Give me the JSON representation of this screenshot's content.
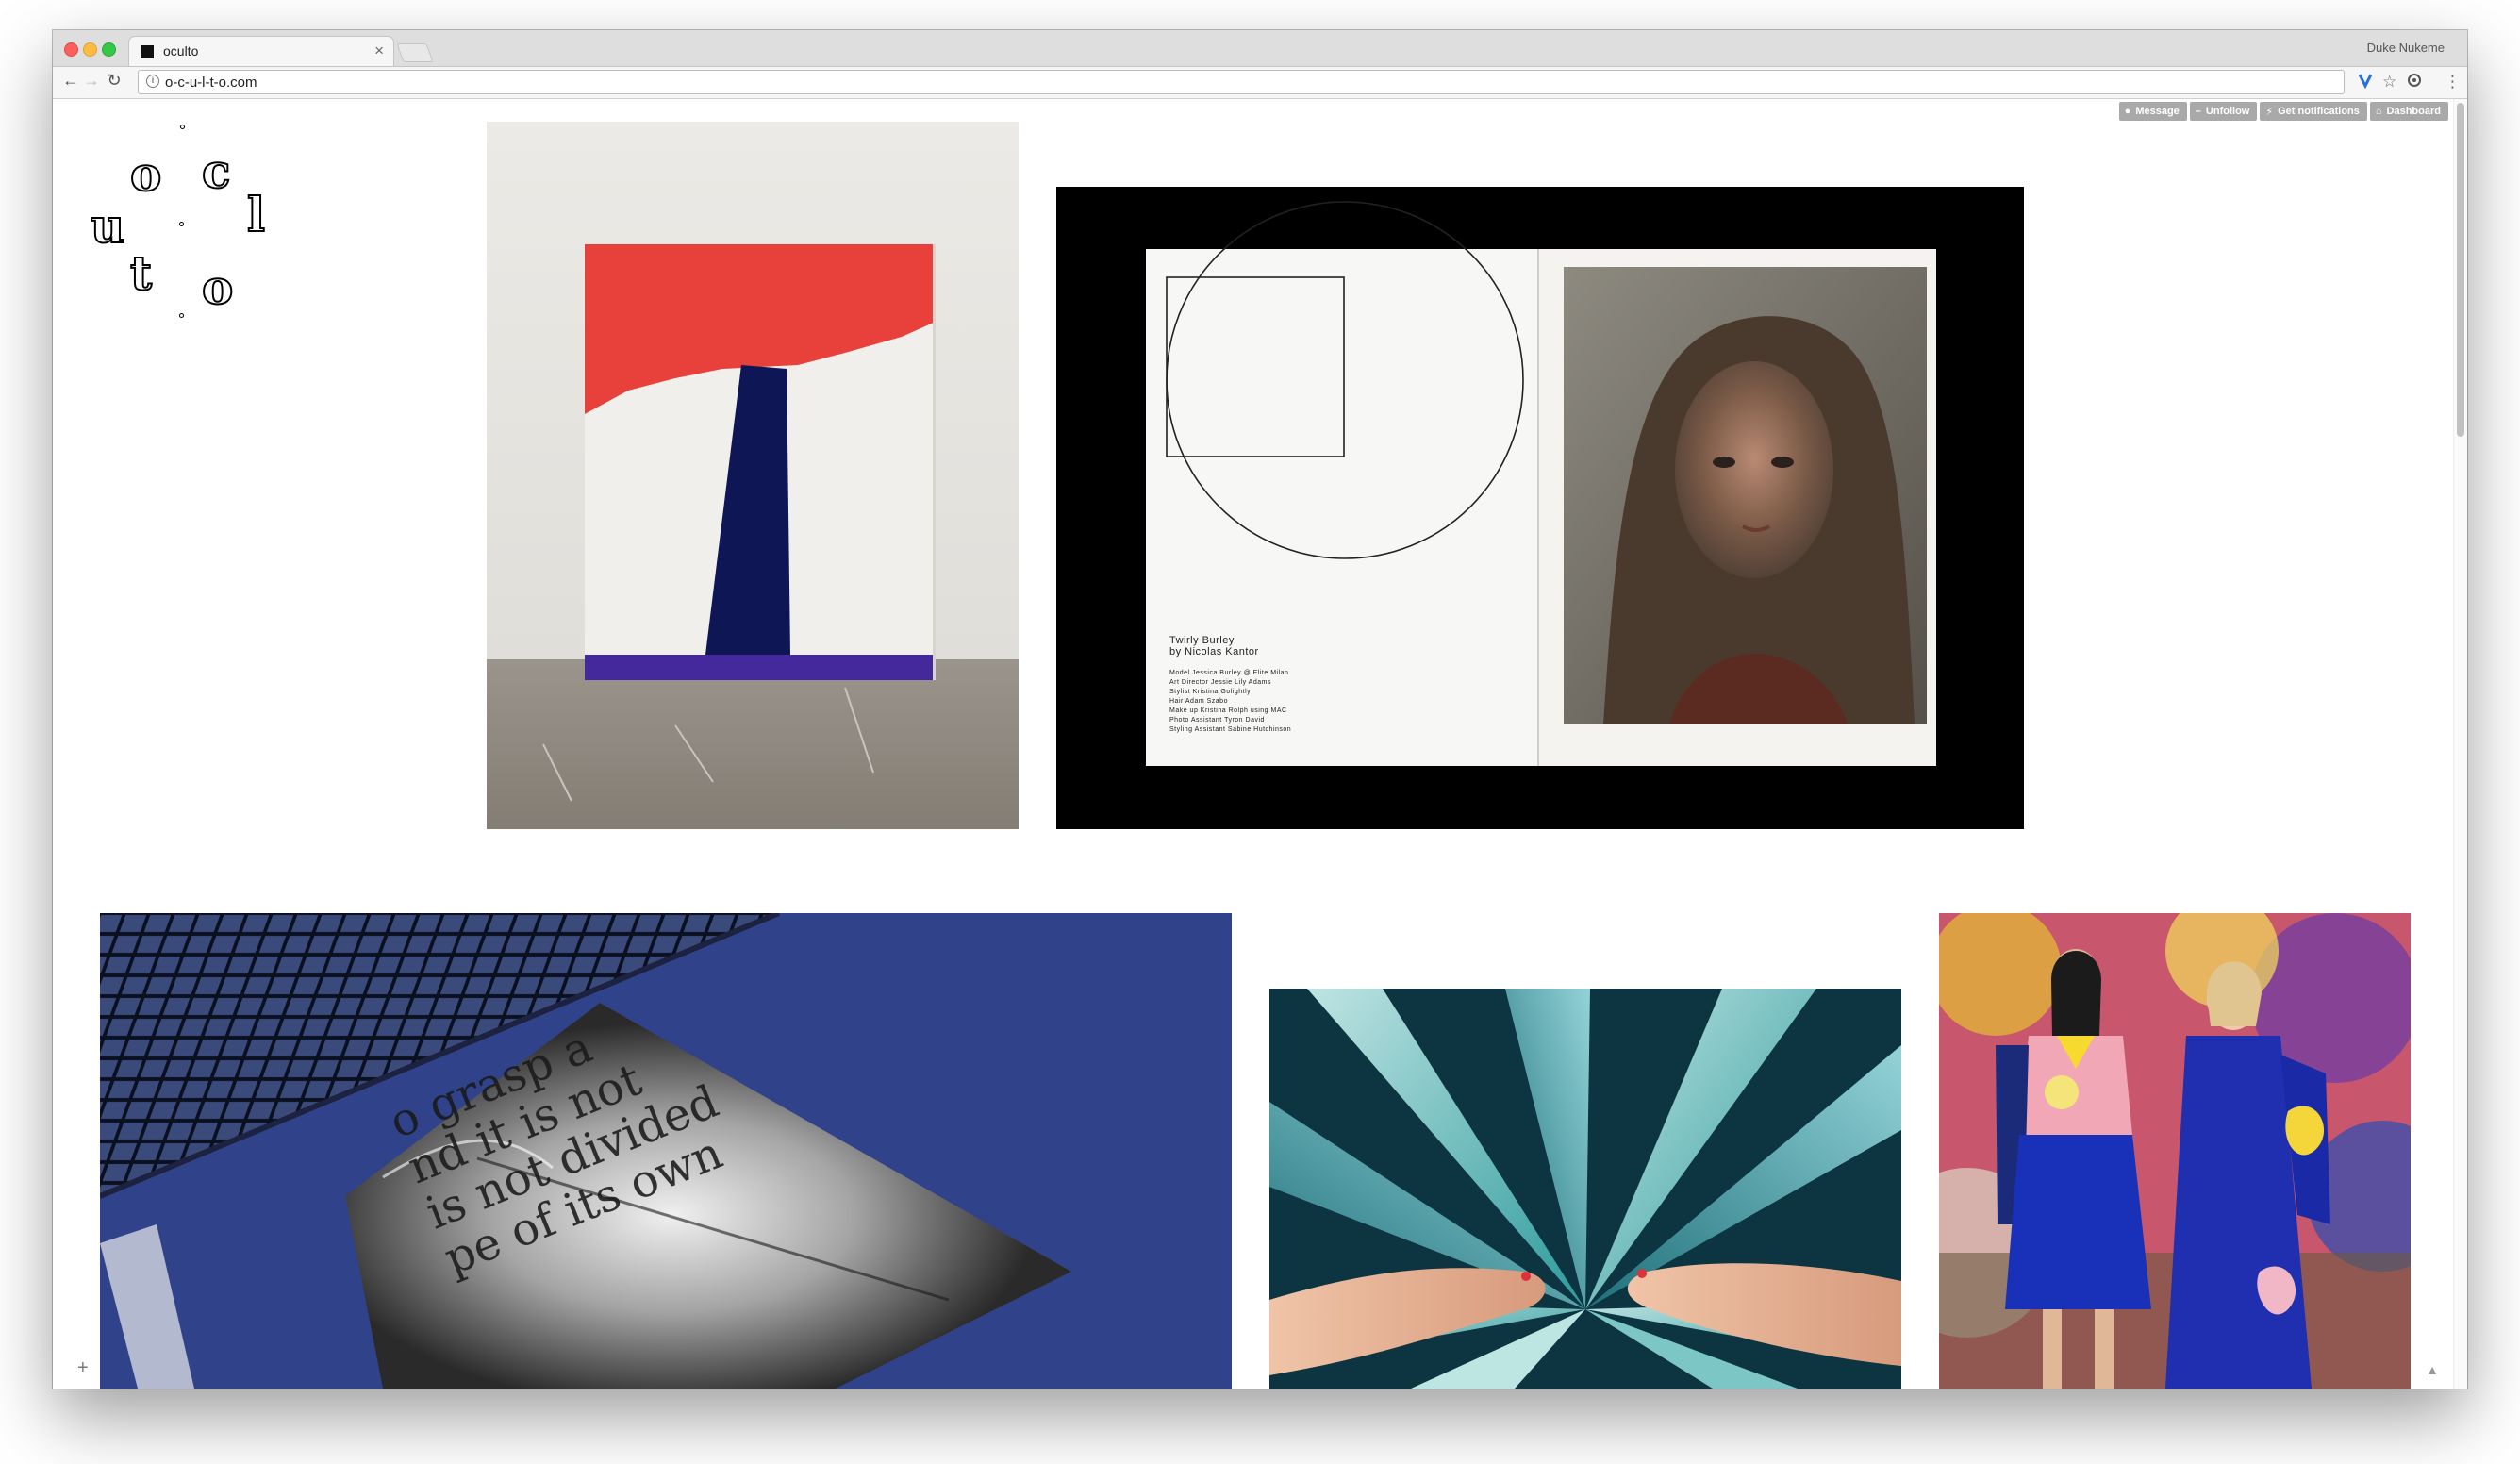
{
  "browser": {
    "tab_title": "oculto",
    "tab_close": "×",
    "profile_name": "Duke Nukeme",
    "url": "o-c-u-l-t-o.com"
  },
  "tumblr_controls": {
    "message": "Message",
    "unfollow": "Unfollow",
    "notifications": "Get notifications",
    "dashboard": "Dashboard"
  },
  "logo": {
    "letters": [
      "o",
      "c",
      "u",
      "l",
      "t",
      "o"
    ]
  },
  "posts": {
    "magazine": {
      "title_line1": "Twirly Burley",
      "title_line2": "by Nicolas Kantor",
      "credits": [
        "Model Jessica Burley @ Elite Milan",
        "Art Director Jessie Lily Adams",
        "Stylist Kristina Golightly",
        "Hair Adam Szabo",
        "Make up Kristina Rolph using MAC",
        "Photo Assistant Tyron David",
        "Styling Assistant Sabine Hutchinson"
      ]
    },
    "print": {
      "lines": [
        "o grasp a",
        "nd it is not",
        "is not divided",
        "pe of its own"
      ]
    }
  },
  "colors": {
    "chrome_bg": "#dedede",
    "tumblr_button": "#a9a9a9",
    "painting_red": "#e8403a",
    "painting_navy": "#0e1655",
    "painting_purple": "#44299c",
    "table_blue": "#30438a"
  },
  "icons": {
    "back": "←",
    "forward": "→",
    "reload": "↻",
    "star": "☆",
    "menu": "⋮",
    "plus": "+",
    "up": "▲"
  }
}
